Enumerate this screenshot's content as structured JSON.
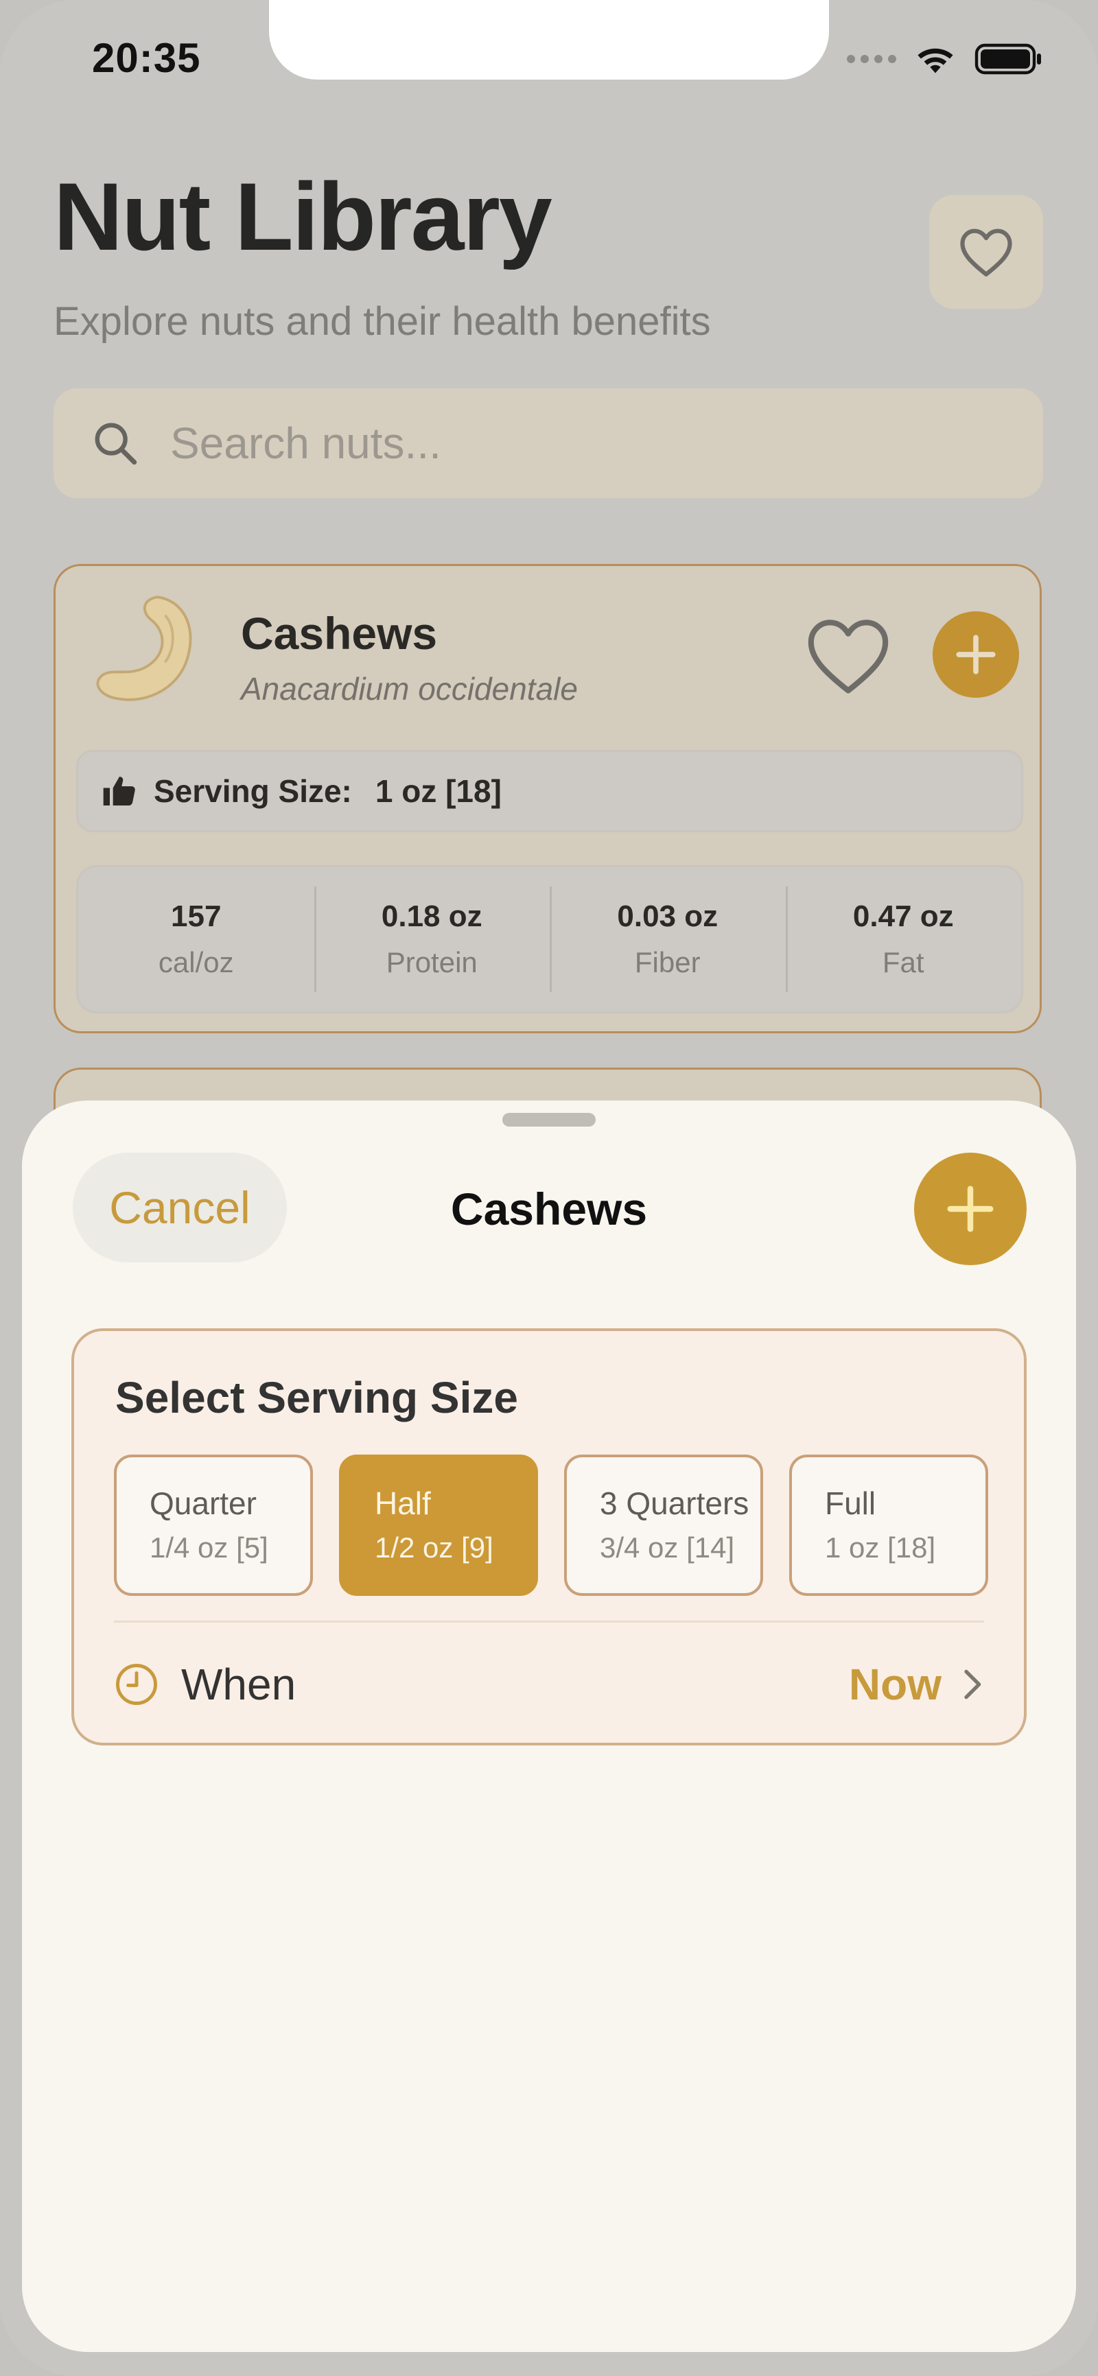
{
  "status_bar": {
    "time": "20:35"
  },
  "library": {
    "title": "Nut Library",
    "subtitle": "Explore nuts and their health benefits",
    "search": {
      "placeholder": "Search nuts..."
    },
    "cards": [
      {
        "name": "Cashews",
        "scientific_name": "Anacardium occidentale",
        "serving_label": "Serving Size:",
        "serving_value": "1 oz [18]",
        "stats": [
          {
            "value": "157",
            "label": "cal/oz"
          },
          {
            "value": "0.18 oz",
            "label": "Protein"
          },
          {
            "value": "0.03 oz",
            "label": "Fiber"
          },
          {
            "value": "0.47 oz",
            "label": "Fat"
          }
        ]
      }
    ]
  },
  "sheet": {
    "cancel_label": "Cancel",
    "title": "Cashews",
    "panel_title": "Select Serving Size",
    "options": [
      {
        "name": "Quarter",
        "size": "1/4 oz [5]",
        "selected": false
      },
      {
        "name": "Half",
        "size": "1/2 oz [9]",
        "selected": true
      },
      {
        "name": "3 Quarters",
        "size": "3/4 oz [14]",
        "selected": false
      },
      {
        "name": "Full",
        "size": "1 oz [18]",
        "selected": false
      }
    ],
    "when_label": "When",
    "when_value": "Now"
  },
  "colors": {
    "accent": "#C99A33",
    "accent_text": "#C79A3C",
    "card_border": "#B98E5A"
  },
  "icons": [
    "signal-icon",
    "wifi-icon",
    "battery-icon",
    "heart-icon",
    "search-icon",
    "cashew-image",
    "plus-icon",
    "thumbs-up-icon",
    "clock-icon",
    "chevron-right-icon"
  ]
}
